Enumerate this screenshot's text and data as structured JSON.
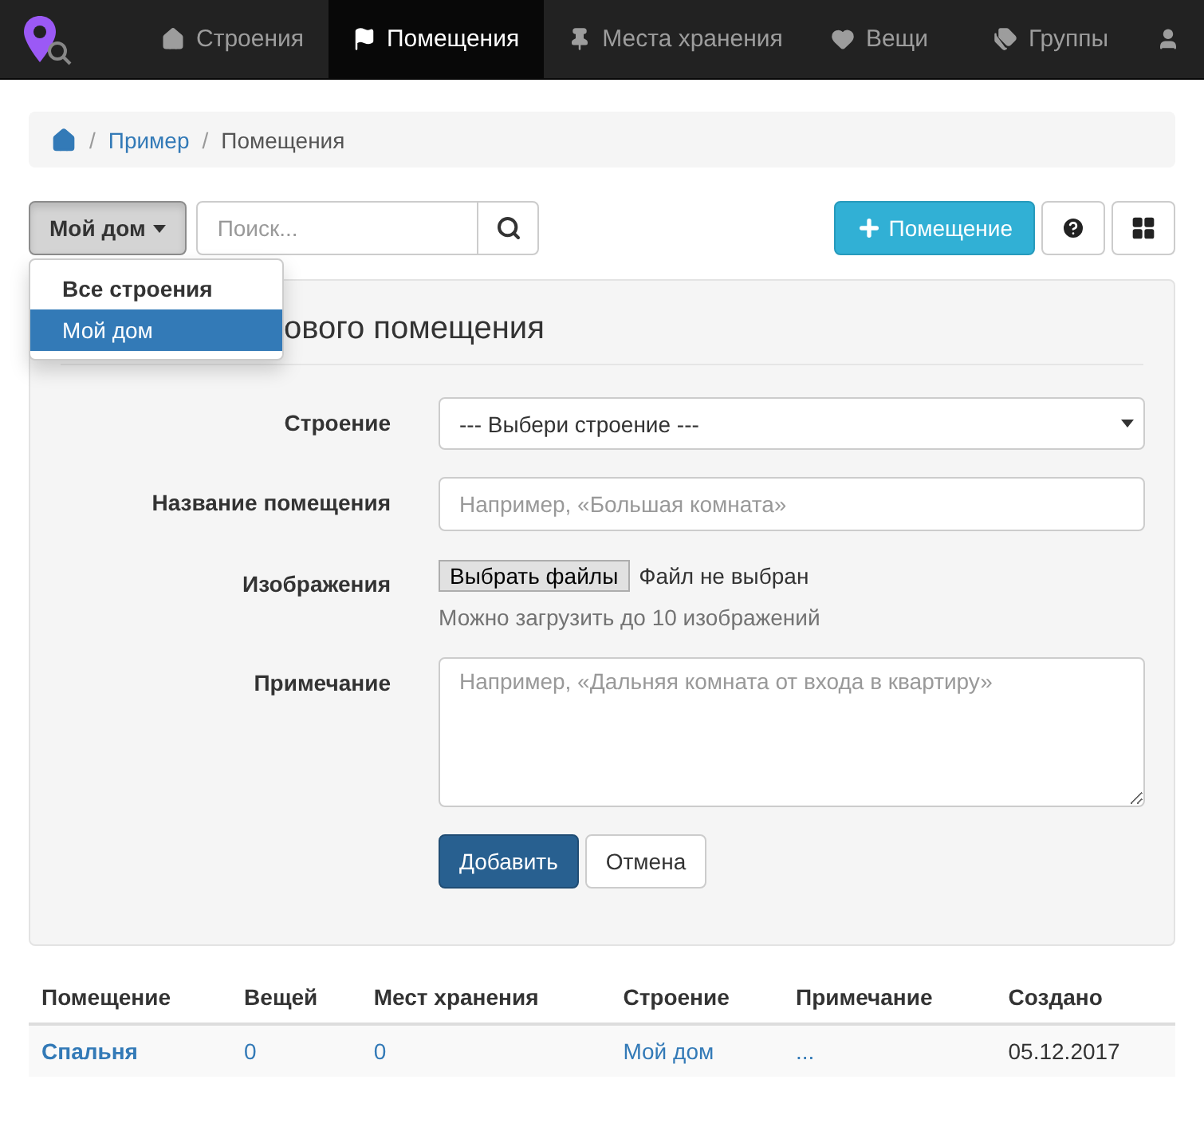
{
  "navbar": {
    "items": [
      {
        "label": "Строения",
        "selected": false
      },
      {
        "label": "Помещения",
        "selected": true
      },
      {
        "label": "Места хранения",
        "selected": false
      },
      {
        "label": "Вещи",
        "selected": false
      }
    ],
    "groups_link": "Группы"
  },
  "breadcrumb_separator": "/",
  "breadcrumb": [
    {
      "label": "Пример",
      "link": true
    },
    {
      "label": "Помещения",
      "link": false
    }
  ],
  "toolbar": {
    "building_button": "Мой дом",
    "search_placeholder": "Поиск...",
    "add_button": "Помещение"
  },
  "dropdown": {
    "items": [
      {
        "label": "Все строения",
        "selected": false,
        "bold": true
      },
      {
        "label": "Мой дом",
        "selected": true,
        "bold": false
      }
    ]
  },
  "form": {
    "title": "ового помещения",
    "fields": [
      {
        "kind": "select",
        "label": "Строение",
        "value": "--- Выбери строение ---"
      },
      {
        "kind": "text",
        "label": "Название помещения",
        "placeholder": "Например, «Большая комната»"
      },
      {
        "kind": "file",
        "label": "Изображения",
        "button": "Выбрать файлы",
        "status": "Файл не выбран",
        "help": "Можно загрузить до 10 изображений"
      },
      {
        "kind": "textarea",
        "label": "Примечание",
        "placeholder": "Например, «Дальняя комната от входа в квартиру»"
      }
    ],
    "submit": "Добавить",
    "cancel": "Отмена"
  },
  "table": {
    "columns": [
      "Помещение",
      "Вещей",
      "Мест хранения",
      "Строение",
      "Примечание",
      "Создано"
    ],
    "rows": [
      [
        "Спальня",
        "0",
        "0",
        "Мой дом",
        "...",
        "05.12.2017"
      ]
    ]
  }
}
